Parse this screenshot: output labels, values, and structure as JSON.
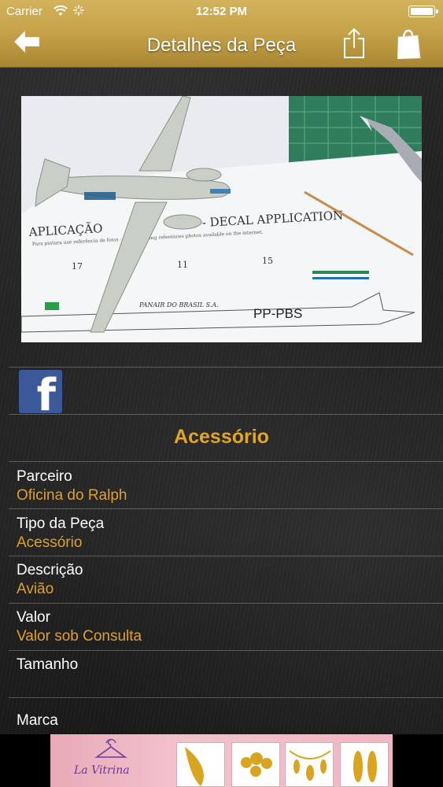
{
  "status_bar": {
    "carrier": "Carrier",
    "time": "12:52 PM"
  },
  "nav": {
    "title": "Detalhes da Peça",
    "back_icon": "back-arrow-icon",
    "share_icon": "share-icon",
    "bag_icon": "shopping-bag-icon"
  },
  "photo": {
    "photo_text_1": "APLICAÇÃO",
    "photo_text_2": "- DECAL APPLICATION",
    "photo_text_3": "PP-PBS",
    "photo_text_4": "PANAIR DO BRASIL S.A.",
    "photo_text_5": "Para pintura use referência de fotos · To paint using references photos available on the internet.",
    "photo_num_1": "17",
    "photo_num_2": "11",
    "photo_num_3": "15"
  },
  "share": {
    "facebook_icon": "facebook-icon",
    "facebook_glyph": "f"
  },
  "category": "Acessório",
  "fields": [
    {
      "label": "Parceiro",
      "value": "Oficina do Ralph"
    },
    {
      "label": "Tipo da Peça",
      "value": "Acessório"
    },
    {
      "label": "Descrição",
      "value": "Avião"
    },
    {
      "label": "Valor",
      "value": "Valor sob Consulta"
    },
    {
      "label": "Tamanho",
      "value": ""
    },
    {
      "label": "Marca",
      "value": ""
    }
  ],
  "ad": {
    "brand": "La Vitrina"
  },
  "colors": {
    "header_gold": "#c7a44a",
    "accent_orange": "#dda12b",
    "facebook_blue": "#3b5998"
  }
}
